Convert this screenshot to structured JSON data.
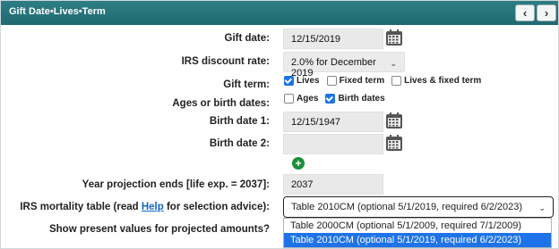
{
  "header": {
    "title": "Gift Date•Lives•Term",
    "prev_label": "‹",
    "next_label": "›"
  },
  "form": {
    "gift_date": {
      "label": "Gift date:",
      "value": "12/15/2019"
    },
    "discount_rate": {
      "label": "IRS discount rate:",
      "selected": "2.0% for December 2019"
    },
    "gift_term": {
      "label": "Gift term:",
      "options": [
        {
          "label": "Lives",
          "checked": true
        },
        {
          "label": "Fixed term",
          "checked": false
        },
        {
          "label": "Lives & fixed term",
          "checked": false
        }
      ]
    },
    "ages_or_birth": {
      "label": "Ages or birth dates:",
      "options": [
        {
          "label": "Ages",
          "checked": false
        },
        {
          "label": "Birth dates",
          "checked": true
        }
      ]
    },
    "birth_date_1": {
      "label": "Birth date 1:",
      "value": "12/15/1947"
    },
    "birth_date_2": {
      "label": "Birth date 2:",
      "value": ""
    },
    "add_label": "+",
    "year_projection": {
      "label": "Year projection ends [life exp. = 2037]:",
      "value": "2037"
    },
    "mortality": {
      "label_pre": "IRS mortality table (read ",
      "help_link": "Help",
      "label_post": " for selection advice):",
      "selected": "Table 2010CM (optional 5/1/2019, required 6/2/2023)",
      "options": [
        "Table 2000CM (optional 5/1/2009, required 7/1/2009)",
        "Table 2010CM (optional 5/1/2019, required 6/2/2023)"
      ]
    },
    "present_values": {
      "label": "Show present values for projected amounts?"
    }
  },
  "colors": {
    "header_bg": "#1f6a72",
    "field_bg": "#e9e9e9",
    "checkbox_on": "#1d73e8",
    "selected_option_bg": "#1e73e8",
    "add_button": "#1e8f3a"
  },
  "icons": [
    "calendar-icon",
    "plus-circle-icon",
    "chevron-down-icon",
    "chevron-left-icon",
    "chevron-right-icon"
  ]
}
